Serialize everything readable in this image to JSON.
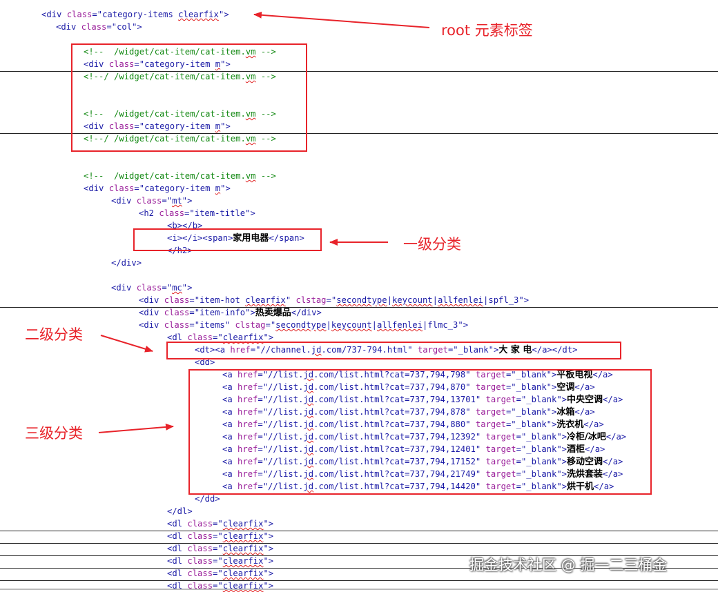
{
  "code_lines": [
    "<div class=\"category-items clearfix\">",
    "<div class=\"col\">",
    "",
    "<!--  /widget/cat-item/cat-item.vm -->",
    "<div class=\"category-item m\">",
    "<!--/ /widget/cat-item/cat-item.vm -->",
    "",
    "",
    "<!--  /widget/cat-item/cat-item.vm -->",
    "<div class=\"category-item m\">",
    "<!--/ /widget/cat-item/cat-item.vm -->",
    "",
    "",
    "<!--  /widget/cat-item/cat-item.vm -->",
    "<div class=\"category-item m\">",
    "<div class=\"mt\">",
    "<h2 class=\"item-title\">",
    "<b></b>",
    "<i></i><span>家用电器</span>",
    "</h2>",
    "</div>",
    "",
    "<div class=\"mc\">",
    "<div class=\"item-hot clearfix\" clstag=\"secondtype|keycount|allfenlei|spfl_3\">",
    "<div class=\"item-info\">热卖爆品</div>",
    "<div class=\"items\" clstag=\"secondtype|keycount|allfenlei|flmc_3\">",
    "<dl class=\"clearfix\">",
    "<dt><a href=\"//channel.jd.com/737-794.html\" target=\"_blank\">大 家 电</a></dt>",
    "<dd>",
    "<a href=\"//list.jd.com/list.html?cat=737,794,798\" target=\"_blank\">平板电视</a>",
    "<a href=\"//list.jd.com/list.html?cat=737,794,870\" target=\"_blank\">空调</a>",
    "<a href=\"//list.jd.com/list.html?cat=737,794,13701\" target=\"_blank\">中央空调</a>",
    "<a href=\"//list.jd.com/list.html?cat=737,794,878\" target=\"_blank\">冰箱</a>",
    "<a href=\"//list.jd.com/list.html?cat=737,794,880\" target=\"_blank\">洗衣机</a>",
    "<a href=\"//list.jd.com/list.html?cat=737,794,12392\" target=\"_blank\">冷柜/冰吧</a>",
    "<a href=\"//list.jd.com/list.html?cat=737,794,12401\" target=\"_blank\">酒柜</a>",
    "<a href=\"//list.jd.com/list.html?cat=737,794,17152\" target=\"_blank\">移动空调</a>",
    "<a href=\"//list.jd.com/list.html?cat=737,794,21749\" target=\"_blank\">洗烘套装</a>",
    "<a href=\"//list.jd.com/list.html?cat=737,794,14420\" target=\"_blank\">烘干机</a>",
    "</dd>",
    "</dl>",
    "<dl class=\"clearfix\">",
    "<dl class=\"clearfix\">",
    "<dl class=\"clearfix\">",
    "<dl class=\"clearfix\">",
    "<dl class=\"clearfix\">",
    "<dl class=\"clearfix\">"
  ],
  "annotations": {
    "root_label": "root 元素标签",
    "level1_label": "一级分类",
    "level2_label": "二级分类",
    "level3_label": "三级分类"
  },
  "watermark": "掘金技术社区 @ 掘一二三桶金",
  "colors": {
    "annotation_red": "#e8232a",
    "tag": "#1a1aa6",
    "attribute": "#9a1f9a",
    "comment": "#118811"
  }
}
